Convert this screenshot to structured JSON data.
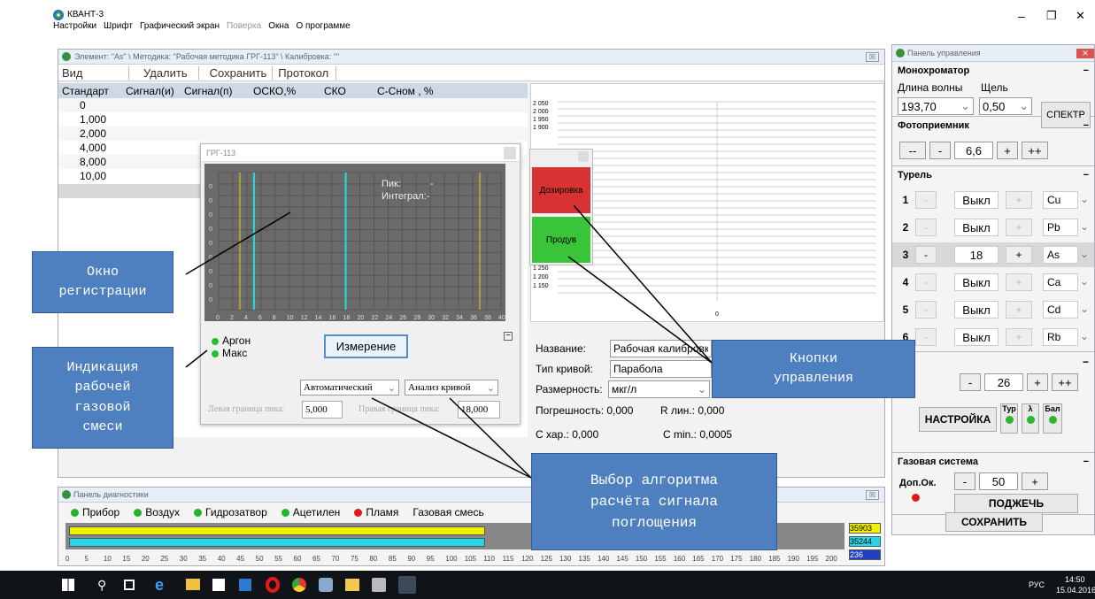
{
  "app": {
    "title": "КВАНТ-3",
    "menu": [
      "Настройки",
      "Шрифт",
      "Графический экран",
      "Поверка",
      "Окна",
      "О программе"
    ],
    "win_controls": [
      "–",
      "❐",
      "✕"
    ]
  },
  "element_window": {
    "title": "Элемент: \"As\" \\ Методика: \"Рабочая методика ГРГ-113\" \\ Калибровка: \"\"",
    "toolbar": [
      "Вид",
      "Удалить",
      "Сохранить",
      "Протокол"
    ],
    "columns": [
      "Стандарт",
      "Сигнал(и)",
      "Сигнал(п)",
      "ОСКО,%",
      "СКО",
      "C-Cном , %"
    ],
    "standards": [
      "0",
      "1,000",
      "2,000",
      "4,000",
      "8,000",
      "10,00"
    ]
  },
  "plot": {
    "y_ticks_top": [
      "2 050",
      "2 000",
      "1 950",
      "1 900"
    ],
    "y_ticks_bottom": [
      "1 300",
      "1 250",
      "1 200",
      "1 150"
    ],
    "x_zero": "0",
    "collapse": "«"
  },
  "registration": {
    "title": "ГРГ-113",
    "peak_label": "Пик:",
    "peak_value": "-",
    "integral_label": "Интеграл:-",
    "x_ticks": [
      "0",
      "2",
      "4",
      "6",
      "8",
      "10",
      "12",
      "14",
      "16",
      "18",
      "20",
      "22",
      "24",
      "26",
      "28",
      "30",
      "32",
      "34",
      "36",
      "38",
      "40"
    ],
    "y_zero": "0"
  },
  "gas_ind": [
    {
      "label": "Аргон",
      "color": "#22c22c"
    },
    {
      "label": "Макс",
      "color": "#22c22c"
    }
  ],
  "measure_button": "Измерение",
  "algorithm": {
    "mode": "Автоматический",
    "analysis": "Анализ кривой",
    "left_label": "Левая граница пика:",
    "left_value": "5,000",
    "right_label": "Правая граница пика:",
    "right_value": "18,000"
  },
  "dose_panel": {
    "dose": "Дозировка",
    "blow": "Продув"
  },
  "calib_form": {
    "name_label": "Название:",
    "name_value": "Рабочая калибровка",
    "curve_label": "Тип кривой:",
    "curve_value": "Парабола",
    "units_label": "Размерность:",
    "units_value": "мкг/л",
    "error_label": "Погрешность: 0,000",
    "rlin_label": "R лин.: 0,000",
    "cchar_label": "С хар.: 0,000",
    "cmin_label": "С min.: 0,0005"
  },
  "control_panel": {
    "title": "Панель управления",
    "mono": {
      "title": "Монохроматор",
      "wavelength_label": "Длина волны",
      "slit_label": "Щель",
      "wavelength": "193,70",
      "slit": "0,50",
      "spectrum": "СПЕКТР"
    },
    "photo": {
      "title": "Фотоприемник",
      "value": "6,6",
      "buttons": [
        "--",
        "-",
        "+",
        "++"
      ]
    },
    "turret": {
      "title": "Турель",
      "rows": [
        {
          "n": "1",
          "state": "Выкл",
          "el": "Cu"
        },
        {
          "n": "2",
          "state": "Выкл",
          "el": "Pb"
        },
        {
          "n": "3",
          "state": "18",
          "el": "As"
        },
        {
          "n": "4",
          "state": "Выкл",
          "el": "Ca"
        },
        {
          "n": "5",
          "state": "Выкл",
          "el": "Cd"
        },
        {
          "n": "6",
          "state": "Выкл",
          "el": "Rb"
        }
      ],
      "minus": "-",
      "plus": "+"
    },
    "lamp": {
      "value": "26",
      "buttons": [
        "-",
        "+",
        "++"
      ]
    },
    "settings": "НАСТРОЙКА",
    "ind": [
      "Тур",
      "λ",
      "Бал"
    ],
    "gas": {
      "title": "Газовая система",
      "dop": "Доп.Ок.",
      "value": "50",
      "minus": "-",
      "plus": "+",
      "ignite": "ПОДЖЕЧЬ"
    },
    "save": "СОХРАНИТЬ"
  },
  "diagnostics": {
    "title": "Панель диагностики",
    "items": [
      {
        "label": "Прибор",
        "color": "#22b52c"
      },
      {
        "label": "Воздух",
        "color": "#22b52c"
      },
      {
        "label": "Гидрозатвор",
        "color": "#22b52c"
      },
      {
        "label": "Ацетилен",
        "color": "#22b52c"
      },
      {
        "label": "Пламя",
        "color": "#e01818"
      }
    ],
    "gas_mix": "Газовая смесь",
    "values": [
      "35903",
      "35244",
      "236"
    ],
    "ticks": [
      "0",
      "5",
      "10",
      "15",
      "20",
      "25",
      "30",
      "35",
      "40",
      "45",
      "50",
      "55",
      "60",
      "65",
      "70",
      "75",
      "80",
      "85",
      "90",
      "95",
      "100",
      "105",
      "110",
      "115",
      "120",
      "125",
      "130",
      "135",
      "140",
      "145",
      "150",
      "155",
      "160",
      "165",
      "170",
      "175",
      "180",
      "185",
      "190",
      "195",
      "200"
    ]
  },
  "callouts": {
    "reg": "Окно\nрегистрации",
    "gas": "Индикация\nрабочей\nгазовой\nсмеси",
    "buttons": "Кнопки\nуправления",
    "algo": "Выбор алгоритма\nрасчёта сигнала\nпоглощения"
  },
  "taskbar": {
    "tray": "РУС",
    "time": "14:50",
    "date": "15.04.2016"
  }
}
